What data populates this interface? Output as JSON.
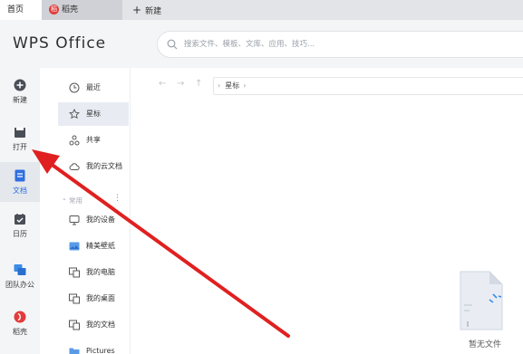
{
  "tabs": [
    {
      "label": "首页"
    },
    {
      "label": "稻壳",
      "logo_text": "稻"
    },
    {
      "label": "新建",
      "icon": "plus-icon"
    }
  ],
  "header": {
    "brand": "WPS Office",
    "search_placeholder": "搜索文件、模板、文库、应用、技巧..."
  },
  "rail": {
    "items": [
      {
        "label": "新建",
        "icon": "plus-circle-icon"
      },
      {
        "label": "打开",
        "icon": "folder-icon"
      },
      {
        "label": "文档",
        "icon": "document-icon",
        "active": true
      },
      {
        "label": "日历",
        "icon": "calendar-icon"
      },
      {
        "label": "团队办公",
        "icon": "team-office-icon"
      },
      {
        "label": "稻壳",
        "icon": "daoke-logo-icon"
      }
    ]
  },
  "nav": {
    "items": [
      {
        "label": "最近",
        "icon": "clock-icon"
      },
      {
        "label": "星标",
        "icon": "star-icon",
        "selected": true
      },
      {
        "label": "共享",
        "icon": "share-icon"
      },
      {
        "label": "我的云文档",
        "icon": "cloud-icon"
      }
    ],
    "section_label": "常用",
    "section_items": [
      {
        "label": "我的设备",
        "icon": "device-icon"
      },
      {
        "label": "精美壁纸",
        "icon": "wallpaper-icon"
      },
      {
        "label": "我的电脑",
        "icon": "computer-icon"
      },
      {
        "label": "我的桌面",
        "icon": "desktop-icon"
      },
      {
        "label": "我的文档",
        "icon": "my-documents-icon"
      },
      {
        "label": "Pictures",
        "icon": "pictures-folder-icon"
      }
    ]
  },
  "main": {
    "breadcrumb": "星标",
    "empty_label": "暂无文件"
  },
  "colors": {
    "accent": "#2f6fe0",
    "annotation_arrow": "#e02020",
    "brand_red": "#e33b3b"
  }
}
